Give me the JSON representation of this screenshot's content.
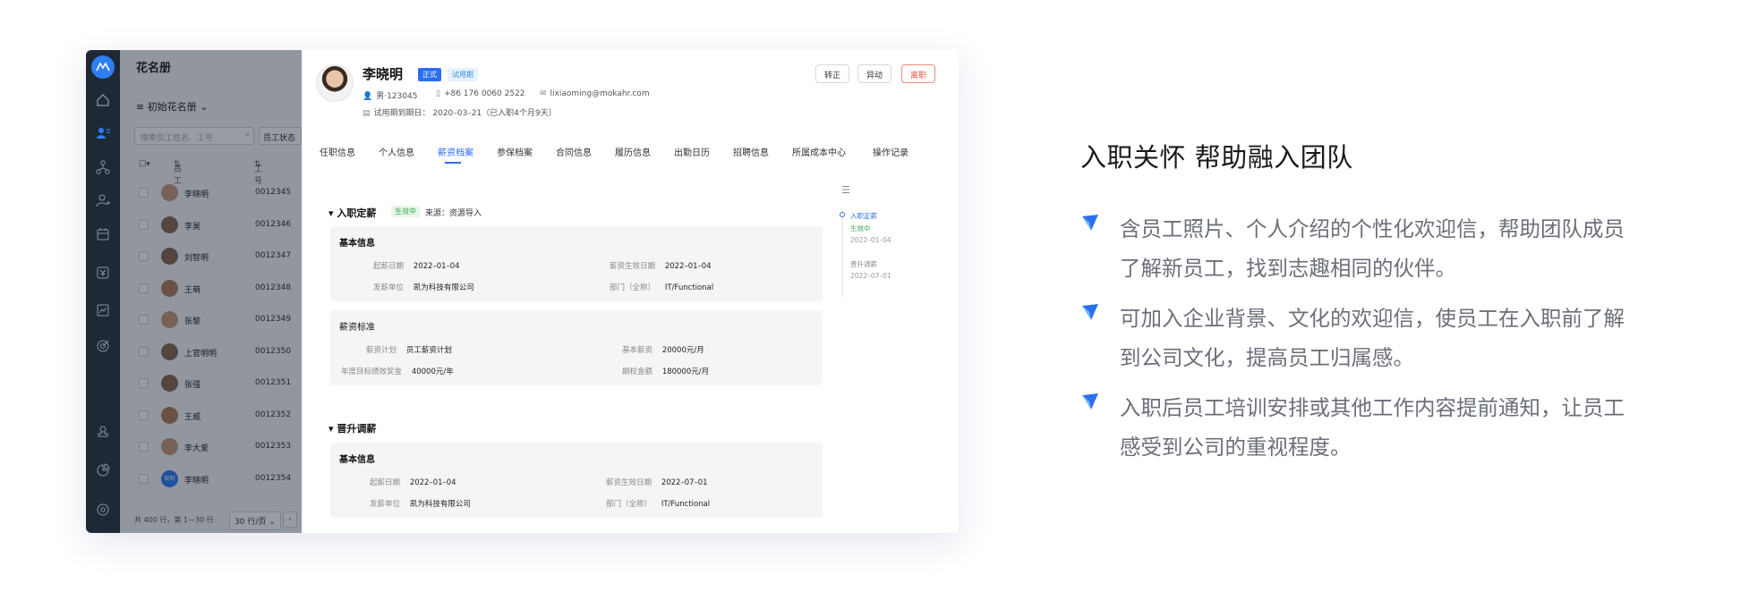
{
  "sidebar": {
    "title": "花名册",
    "roster_select": "初始花名册",
    "search_placeholder": "搜索员工姓名、工号",
    "status_filter": "员工状态",
    "col_employee": "员工",
    "col_id": "工号",
    "rows": [
      {
        "name": "李晓明",
        "id": "0012345"
      },
      {
        "name": "李昊",
        "id": "0012346"
      },
      {
        "name": "刘智明",
        "id": "0012347"
      },
      {
        "name": "王萌",
        "id": "0012348"
      },
      {
        "name": "张黎",
        "id": "0012349"
      },
      {
        "name": "上官明明",
        "id": "0012350"
      },
      {
        "name": "张强",
        "id": "0012351"
      },
      {
        "name": "王威",
        "id": "0012352"
      },
      {
        "name": "李大爱",
        "id": "0012353"
      },
      {
        "name": "李晓明",
        "id": "0012354",
        "badge": "晓明"
      }
    ],
    "pager_info": "共 400 行，第 1—30 行",
    "page_size": "30 行/页"
  },
  "profile": {
    "name": "李晓明",
    "tag_formal": "正式",
    "tag_trial": "试用期",
    "gender_id": "男·123045",
    "phone": "+86 176 0060 2522",
    "email": "lixiaoming@mokahr.com",
    "probation": "试用期到期日：  2020–03–21（已入职4个月9天）",
    "btn_regular": "转正",
    "btn_transfer": "异动",
    "btn_leave": "离职"
  },
  "tabs": [
    "任职信息",
    "个人信息",
    "薪资档案",
    "参保档案",
    "合同信息",
    "履历信息",
    "出勤日历",
    "招聘信息",
    "所属成本中心",
    "操作记录"
  ],
  "salary_onboard": {
    "title": "入职定薪",
    "status": "生效中",
    "source": "来源：资源导入",
    "basic_title": "基本信息",
    "start_date_k": "起薪日期",
    "start_date_v": "2022–01–04",
    "effective_k": "薪资生效日期",
    "effective_v": "2022–01–04",
    "payer_k": "发薪单位",
    "payer_v": "凯为科技有限公司",
    "dept_k": "部门（全称）",
    "dept_v": "IT/Functional",
    "std_title": "薪资标准",
    "plan_k": "薪资计划",
    "plan_v": "员工薪资计划",
    "base_k": "基本薪资",
    "base_v": "20000元/月",
    "bonus_k": "年度目标绩效奖金",
    "bonus_v": "40000元/年",
    "option_k": "期权金额",
    "option_v": "180000元/月"
  },
  "salary_promo": {
    "title": "晋升调薪",
    "basic_title": "基本信息",
    "start_date_k": "起薪日期",
    "start_date_v": "2022–01–04",
    "effective_k": "薪资生效日期",
    "effective_v": "2022–07–01",
    "payer_k": "发薪单位",
    "payer_v": "凯为科技有限公司",
    "dept_k": "部门（全称）",
    "dept_v": "IT/Functional"
  },
  "timeline": {
    "item1_title": "入职定薪",
    "item1_status": "生效中",
    "item1_date": "2022–01–04",
    "item2_title": "晋升调薪",
    "item2_date": "2022–07–01"
  },
  "marketing": {
    "heading": "入职关怀 帮助融入团队",
    "bullets": [
      "含员工照片、个人介绍的个性化欢迎信，帮助团队成员了解新员工，找到志趣相同的伙伴。",
      "可加入企业背景、文化的欢迎信，使员工在入职前了解到公司文化，提高员工归属感。",
      "入职后员工培训安排或其他工作内容提前通知，让员工感受到公司的重视程度。"
    ]
  },
  "colors": {
    "accent": "#2a6ff0",
    "danger": "#e9573f",
    "success": "#3aa757",
    "rail": "#1f2936"
  }
}
